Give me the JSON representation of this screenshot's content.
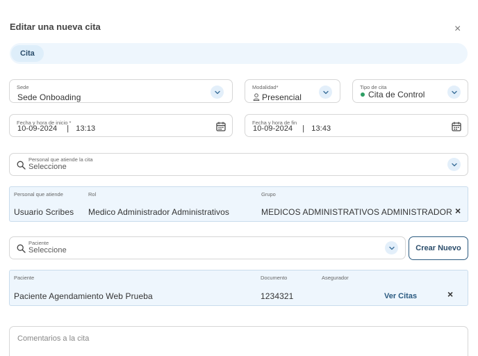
{
  "modal": {
    "title": "Editar una nueva cita",
    "close_glyph": "×"
  },
  "tabs": [
    {
      "label": "Cita"
    }
  ],
  "form": {
    "sede": {
      "label": "Sede",
      "value": "Sede Onboading"
    },
    "modalidad": {
      "label": "Modalidad*",
      "value": "Presencial",
      "icon": "person-icon"
    },
    "tipo": {
      "label": "Tipo de cita",
      "value": "Cita de Control",
      "status_color": "#2e9e64"
    },
    "inicio": {
      "label": "Fecha y hora de inicio *",
      "date": "10-09-2024",
      "time": "13:13",
      "sep": "|"
    },
    "fin": {
      "label": "Fecha y hora de fin",
      "date": "10-09-2024",
      "time": "13:43",
      "sep": "|"
    },
    "personal": {
      "label": "Personal que atiende la cita",
      "placeholder": "Seleccione"
    },
    "paciente": {
      "label": "Paciente",
      "placeholder": "Seleccione"
    },
    "crear_nuevo": "Crear Nuevo",
    "comentarios_placeholder": "Comentarios a la cita"
  },
  "staff_table": {
    "headers": {
      "personal": "Personal que atiende",
      "rol": "Rol",
      "grupo": "Grupo"
    },
    "row": {
      "personal": "Usuario Scribes",
      "rol": "Medico Administrador Administrativos",
      "grupo": "MEDICOS ADMINISTRATIVOS ADMINISTRADOR"
    },
    "remove_glyph": "×"
  },
  "patient_table": {
    "headers": {
      "paciente": "Paciente",
      "documento": "Documento",
      "asegurador": "Asegurador"
    },
    "row": {
      "paciente": "Paciente Agendamiento Web Prueba",
      "documento": "1234321",
      "link": "Ver Citas"
    },
    "remove_glyph": "×"
  },
  "colors": {
    "accent": "#2b5a7f",
    "panel_bg": "#eef6fd",
    "chevron_bg": "#e3effa"
  }
}
